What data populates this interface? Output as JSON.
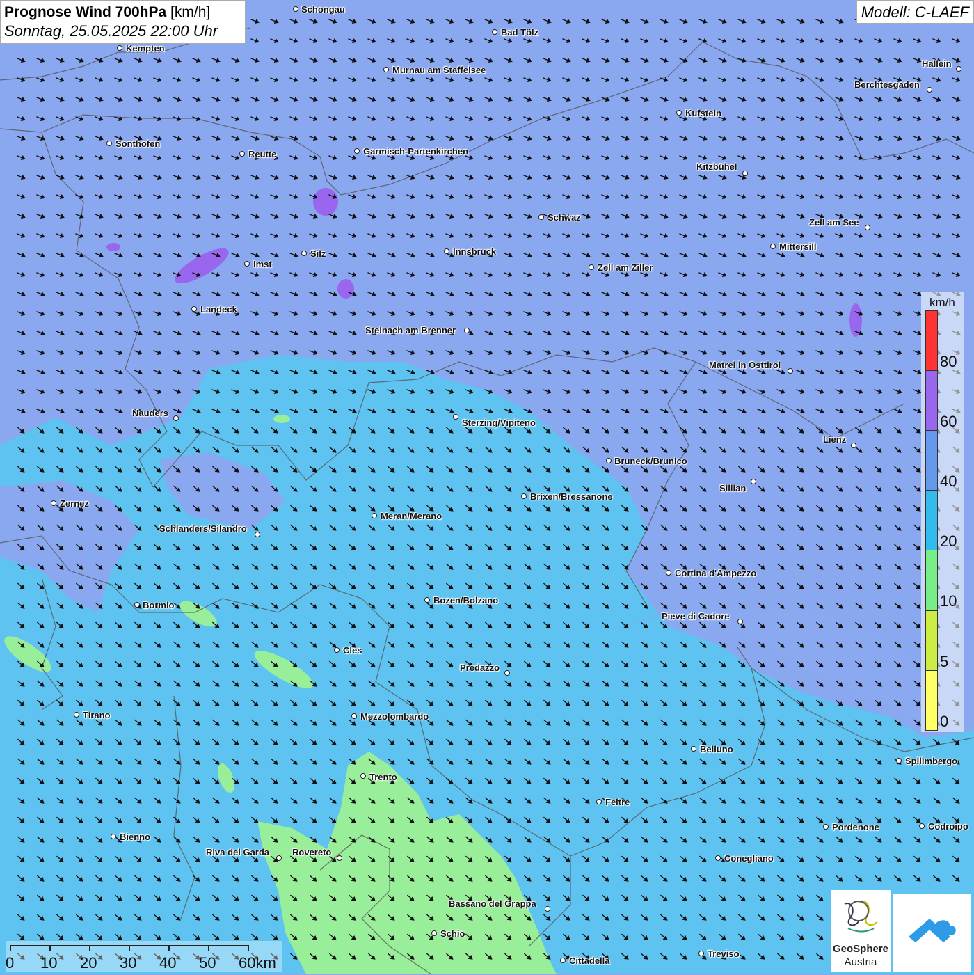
{
  "title": {
    "bold": "Prognose Wind 700hPa",
    "unit": " [km/h]",
    "subtitle": "Sonntag, 25.05.2025 22:00 Uhr"
  },
  "model": "Modell: C-LAEF",
  "legend": {
    "unit": "km/h",
    "labels": [
      "80",
      "60",
      "40",
      "20",
      "10",
      "5",
      "0"
    ],
    "colors": [
      "#ff3333",
      "#9966ee",
      "#6699ee",
      "#33bbee",
      "#77ee88",
      "#ccee44",
      "#ffff66"
    ]
  },
  "scale": {
    "labels": [
      "0",
      "10",
      "20",
      "30",
      "40",
      "50",
      "60km"
    ]
  },
  "logo": {
    "name": "GeoSphere",
    "sub": "Austria"
  },
  "cities": [
    "Schongau",
    "Bad Tölz",
    "Kempten",
    "Murnau am Staffelsee",
    "Hallein",
    "Berchtesgaden",
    "Kufstein",
    "Sonthofen",
    "Reutte",
    "Garmisch-Partenkirchen",
    "Kitzbühel",
    "Schwaz",
    "Zell am See",
    "Mittersill",
    "Innsbruck",
    "Silz",
    "Imst",
    "Zell am Ziller",
    "Landeck",
    "Steinach am Brenner",
    "Matrei in Osttirol",
    "Nauders",
    "Sterzing/Vipiteno",
    "Lienz",
    "Bruneck/Brunico",
    "Sillian",
    "Zernez",
    "Brixen/Bressanone",
    "Meran/Merano",
    "Schlanders/Silandro",
    "Cortina d'Ampezzo",
    "Bozen/Bolzano",
    "Bormio",
    "Pieve di Cadore",
    "Cles",
    "Predazzo",
    "Tirano",
    "Mezzolombardo",
    "Belluno",
    "Spilimbergo",
    "Trento",
    "Feltre",
    "Pordenone",
    "Codroipo",
    "Bienno",
    "Riva del Garda",
    "Rovereto",
    "Conegliano",
    "Bassano del Grappa",
    "Schio",
    "Treviso",
    "Cittadella"
  ],
  "colors": {
    "wind_40_60": "#8aa8f0",
    "wind_20_40": "#5cc4f0",
    "wind_10_20": "#99ee99",
    "wind_60_80": "#9966ee"
  }
}
